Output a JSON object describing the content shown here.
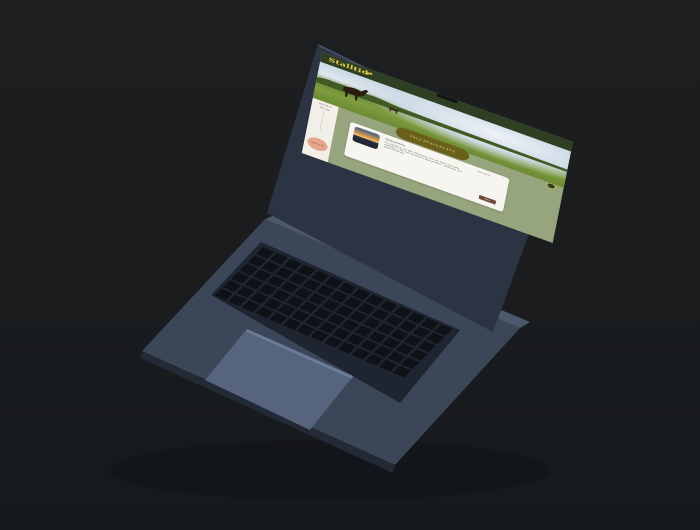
{
  "site": {
    "logo_text": "Stalltid",
    "accent": "#e7cf45",
    "topbar_color": "#2e3f24"
  },
  "sidebar": {
    "date_label": "2024-06-03",
    "item_label": "Min sida",
    "action_button": "Boka ny tid"
  },
  "main": {
    "cta_label": "VÄLJ STALLPLATS",
    "card": {
      "title": "Välkommen",
      "body": "En plattform för alla hästägare som vill hitta och boka stallplats. Här kan du hitta lediga platser i närheten och boka tid direkt.",
      "side_text": "2024-06-03",
      "button_label": "Boka"
    }
  },
  "icons": [
    "horse-logo-icon",
    "help-icon"
  ]
}
